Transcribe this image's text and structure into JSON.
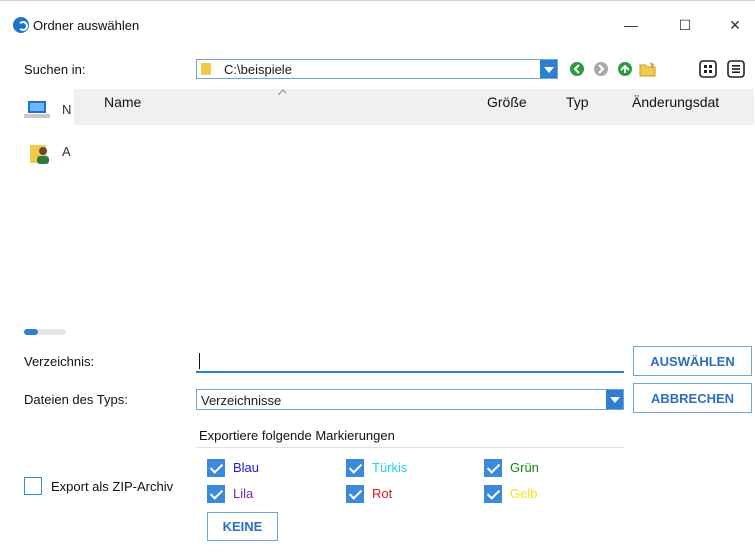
{
  "window": {
    "title": "Ordner auswählen",
    "controls": {
      "minimize": "—",
      "maximize": "☐",
      "close": "✕"
    }
  },
  "lookin": {
    "label": "Suchen in:",
    "value": "C:\\beispiele"
  },
  "toolbar": {
    "icons": [
      "back-icon",
      "forward-icon",
      "up-icon",
      "new-folder-icon",
      "list-view-icon",
      "details-view-icon"
    ]
  },
  "sidebar": {
    "items": [
      {
        "label": "N",
        "icon": "computer-icon"
      },
      {
        "label": "A",
        "icon": "user-folder-icon"
      }
    ]
  },
  "filelist": {
    "columns": [
      "Name",
      "Größe",
      "Typ",
      "Änderungsdat"
    ]
  },
  "directory": {
    "label": "Verzeichnis:",
    "value": ""
  },
  "filetype": {
    "label": "Dateien des Typs:",
    "value": "Verzeichnisse"
  },
  "buttons": {
    "select": "AUSWÄHLEN",
    "cancel": "ABBRECHEN",
    "none": "KEINE"
  },
  "export": {
    "heading": "Exportiere folgende Markierungen",
    "zip_label": "Export als ZIP-Archiv",
    "zip_checked": false,
    "marks": [
      {
        "label": "Blau",
        "color": "#1a1ae6",
        "checked": true
      },
      {
        "label": "Türkis",
        "color": "#22d3e6",
        "checked": true
      },
      {
        "label": "Grün",
        "color": "#138a13",
        "checked": true
      },
      {
        "label": "Lila",
        "color": "#7b2a9a",
        "checked": true
      },
      {
        "label": "Rot",
        "color": "#e01818",
        "checked": true
      },
      {
        "label": "Gelb",
        "color": "#f2e21a",
        "checked": true
      }
    ]
  },
  "colors": {
    "accent": "#2d7fd0",
    "button_text": "#2d6fbd"
  }
}
